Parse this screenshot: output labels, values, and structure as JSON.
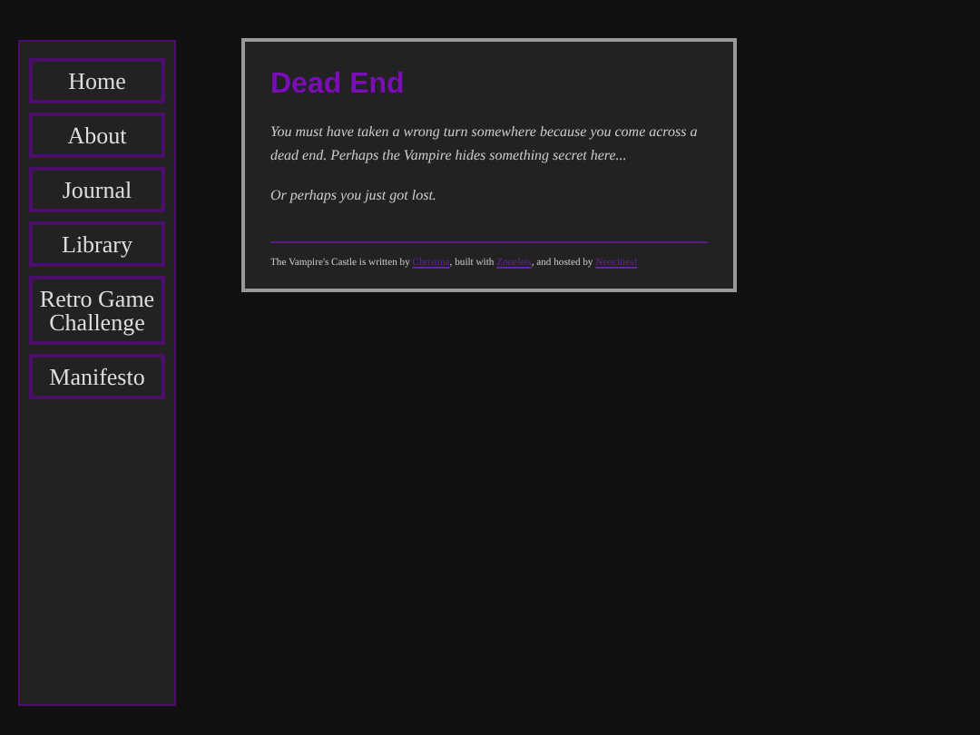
{
  "nav": [
    {
      "label": "Home"
    },
    {
      "label": "About"
    },
    {
      "label": "Journal"
    },
    {
      "label": "Library"
    },
    {
      "label": "Retro Game Challenge"
    },
    {
      "label": "Manifesto"
    }
  ],
  "main": {
    "title": "Dead End",
    "paragraphs": [
      "You must have taken a wrong turn somewhere because you come across a dead end. Perhaps the Vampire hides something secret here...",
      "Or perhaps you just got lost."
    ],
    "footer": [
      {
        "kind": "text",
        "text": "The Vampire's Castle is written by "
      },
      {
        "kind": "link",
        "text": "Christina"
      },
      {
        "kind": "text",
        "text": ", built with "
      },
      {
        "kind": "link",
        "text": "Zonelets"
      },
      {
        "kind": "text",
        "text": ", and hosted by "
      },
      {
        "kind": "link",
        "text": "Neocities!"
      }
    ]
  }
}
